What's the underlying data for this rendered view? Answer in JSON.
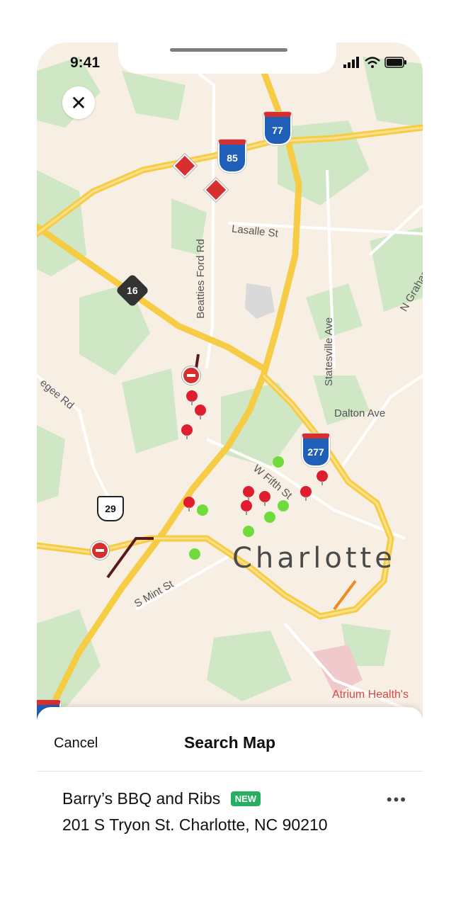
{
  "status_bar": {
    "time": "9:41"
  },
  "map": {
    "city": "Charlotte",
    "streets": [
      "Lasalle St",
      "Beatties Ford Rd",
      "Statesville Ave",
      "N Graham",
      "Dalton Ave",
      "W Fifth St",
      "S Mint St",
      "egee Rd"
    ],
    "shields": {
      "i77_top": "77",
      "i85": "85",
      "nc16": "16",
      "i277": "277",
      "us29": "29",
      "i77_bottom": "77"
    },
    "poi": "Atrium Health's",
    "pins": {
      "red_count": 12,
      "green_count": 7
    }
  },
  "sheet": {
    "cancel_label": "Cancel",
    "title": "Search Map",
    "result": {
      "name": "Barry’s BBQ and Ribs",
      "badge": "NEW",
      "address": "201 S Tryon St. Charlotte, NC 90210",
      "more": "•••"
    }
  },
  "colors": {
    "accent_red": "#e01d2f",
    "accent_green": "#6fdc3c",
    "badge_green": "#27ae60",
    "highway": "#f6cc45"
  }
}
